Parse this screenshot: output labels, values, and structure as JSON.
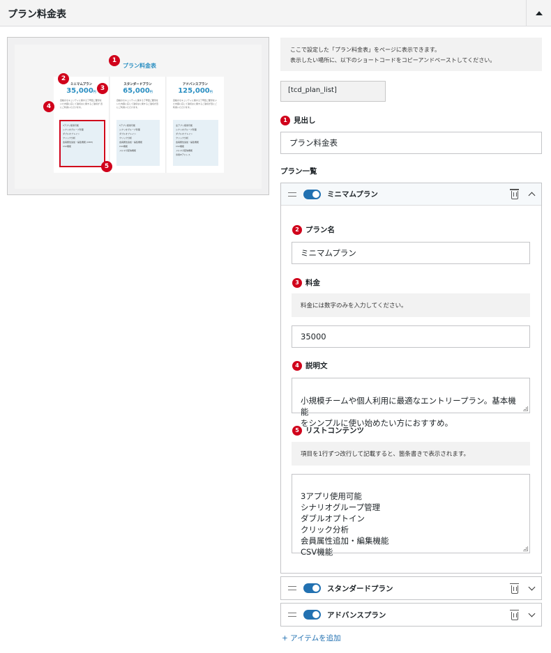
{
  "panel": {
    "title": "プラン料金表"
  },
  "preview": {
    "heading": "プラン料金表",
    "unit": "円",
    "cards": [
      {
        "name": "ミニマムプラン",
        "price": "35,000",
        "desc": "自動のセキュリティに関する丁寧回ご要望をいた内容に応じて適切なに関するご適切が 迅にご利用いただけます。",
        "items": [
          "3アプリ使用可能",
          "シナリオグループ管理",
          "ダブルオプトイン",
          "クリック分析",
          "会員属性追加・編集機能 (CRM)",
          "CSV機能"
        ]
      },
      {
        "name": "スタンダードプラン",
        "price": "65,000",
        "desc": "自動のセキュリティに関する丁寧回ご要望をいた内容に応じて適切なに関するご適切が迅にご利用いただけます。",
        "items": [
          "5アプリ使用可能",
          "シナリオグループ管理",
          "ダブルオプトイン",
          "クリック分析",
          "会員属性追加・編集機能",
          "CSV機能",
          "メルマガ配信機能"
        ]
      },
      {
        "name": "アドバンスプラン",
        "price": "125,000",
        "desc": "自動のセキュリティに関する丁寧回ご要望をいた内容に応じて適切なに関するご適切が迅にご利用いただけます。",
        "items": [
          "全アプリ使用可能",
          "シナリオグループ管理",
          "ダブルオプトイン",
          "クリック分析",
          "会員属性追加・編集機能",
          "CSV機能",
          "メルマガ配信機能",
          "専用IPアドレス"
        ]
      }
    ],
    "markers": [
      "1",
      "2",
      "3",
      "4",
      "5"
    ]
  },
  "info": {
    "line1": "ここで設定した「プラン料金表」をページに表示できます。",
    "line2": "表示したい場所に、以下のショートコードをコピーアンドペーストしてください。"
  },
  "shortcode": "[tcd_plan_list]",
  "heading_field": {
    "num": "1",
    "label": "見出し",
    "value": "プラン料金表"
  },
  "plan_list_label": "プラン一覧",
  "plans": [
    {
      "title": "ミニマムプラン",
      "enabled": true,
      "name_field": {
        "num": "2",
        "label": "プラン名",
        "value": "ミニマムプラン"
      },
      "price_field": {
        "num": "3",
        "label": "料金",
        "note": "料金には数字のみを入力してください。",
        "value": "35000"
      },
      "desc_field": {
        "num": "4",
        "label": "説明文",
        "value": "小規模チームや個人利用に最適なエントリープラン。基本機能\nをシンプルに使い始めたい方におすすめ。"
      },
      "list_field": {
        "num": "5",
        "label": "リストコンテンツ",
        "note": "項目を1行ずつ改行して記載すると、箇条書きで表示されます。",
        "value": "3アプリ使用可能\nシナリオグループ管理\nダブルオプトイン\nクリック分析\n会員属性追加・編集機能\nCSV機能"
      }
    },
    {
      "title": "スタンダードプラン",
      "enabled": true
    },
    {
      "title": "アドバンスプラン",
      "enabled": true
    }
  ],
  "add_item": "+ アイテムを追加",
  "colors": {
    "accent": "#2271b1",
    "marker": "#d0021b",
    "price": "#2b8fc2"
  }
}
